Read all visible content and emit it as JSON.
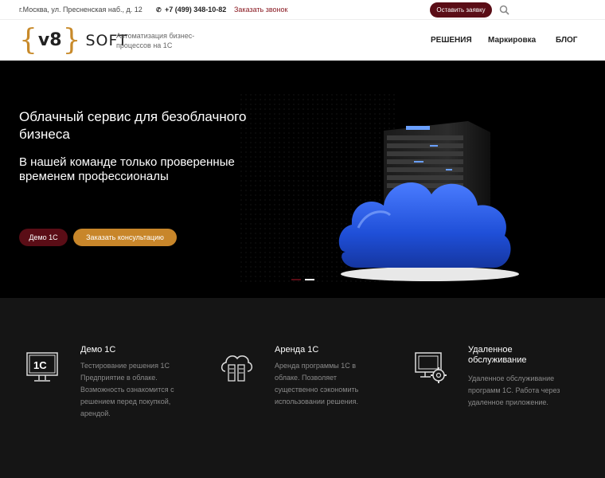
{
  "topbar": {
    "address": "г.Москва, ул. Пресненская наб., д. 12",
    "phone": "+7 (499) 348-10-82",
    "callback": "Заказать звонок",
    "apply_button": "Оставить заявку",
    "search_icon": "search-icon"
  },
  "header": {
    "logo": {
      "brace_left": "{",
      "v8": "v8",
      "brace_right": "}",
      "soft": "SOFT"
    },
    "tagline": "Автоматизация бизнес-процессов на 1С",
    "nav": [
      {
        "label": "РЕШЕНИЯ"
      },
      {
        "label": "Маркировка"
      },
      {
        "label": "БЛОГ"
      }
    ]
  },
  "hero": {
    "title": "Облачный сервис для безоблачного бизнеса",
    "subtitle": "В нашей команде только проверенные временем профессионалы",
    "btn_demo": "Демо 1С",
    "btn_consult": "Заказать консультацию",
    "slides": 2,
    "active_slide": 2
  },
  "features": [
    {
      "title": "Демо 1С",
      "desc": "Тестирование решения 1С Предприятие в облаке. Возможность ознакомится с решением перед покупкой, арендой.",
      "icon": "monitor-1c-icon"
    },
    {
      "title": "Аренда 1С",
      "desc": "Аренда программы 1С в облаке. Позволяет существенно сэкономить использовании решения.",
      "icon": "cloud-servers-icon"
    },
    {
      "title": "Удаленное обслуживание",
      "desc": "Удаленное обслуживание программ 1С. Работа через удаленное приложение.",
      "icon": "monitor-gear-icon"
    }
  ],
  "colors": {
    "brand_dark": "#5a0d16",
    "brand_gold": "#c8862a",
    "link_red": "#8a1a22"
  }
}
